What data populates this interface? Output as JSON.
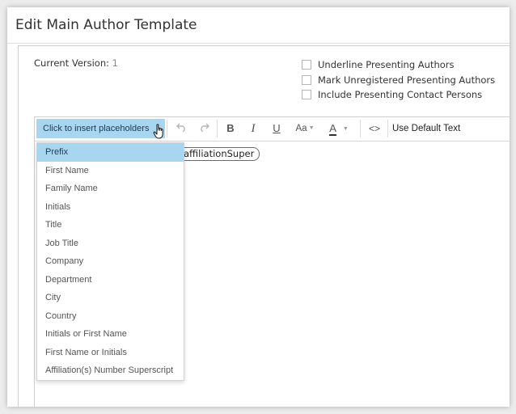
{
  "dialog": {
    "title": "Edit Main Author Template"
  },
  "version": {
    "label": "Current Version:",
    "value": "1"
  },
  "options": [
    {
      "label": "Underline Presenting Authors",
      "checked": false
    },
    {
      "label": "Mark Unregistered Presenting Authors",
      "checked": false
    },
    {
      "label": "Include Presenting Contact Persons",
      "checked": false
    }
  ],
  "toolbar": {
    "insert_label": "Click to insert placeholders",
    "undo_icon": "undo-icon",
    "redo_icon": "redo-icon",
    "bold": "B",
    "italic": "I",
    "underline": "U",
    "font_size": "Aa",
    "font_color": "A",
    "code": "<>",
    "default_text": "Use Default Text"
  },
  "editor": {
    "placeholder_chip": "affiliationSuper"
  },
  "dropdown": {
    "items": [
      "Prefix",
      "First Name",
      "Family Name",
      "Initials",
      "Title",
      "Job Title",
      "Company",
      "Department",
      "City",
      "Country",
      "Initials or First Name",
      "First Name or Initials",
      "Affiliation(s) Number Superscript"
    ]
  },
  "colors": {
    "accent": "#a8d6f1",
    "text": "#333333",
    "muted": "#888888"
  }
}
